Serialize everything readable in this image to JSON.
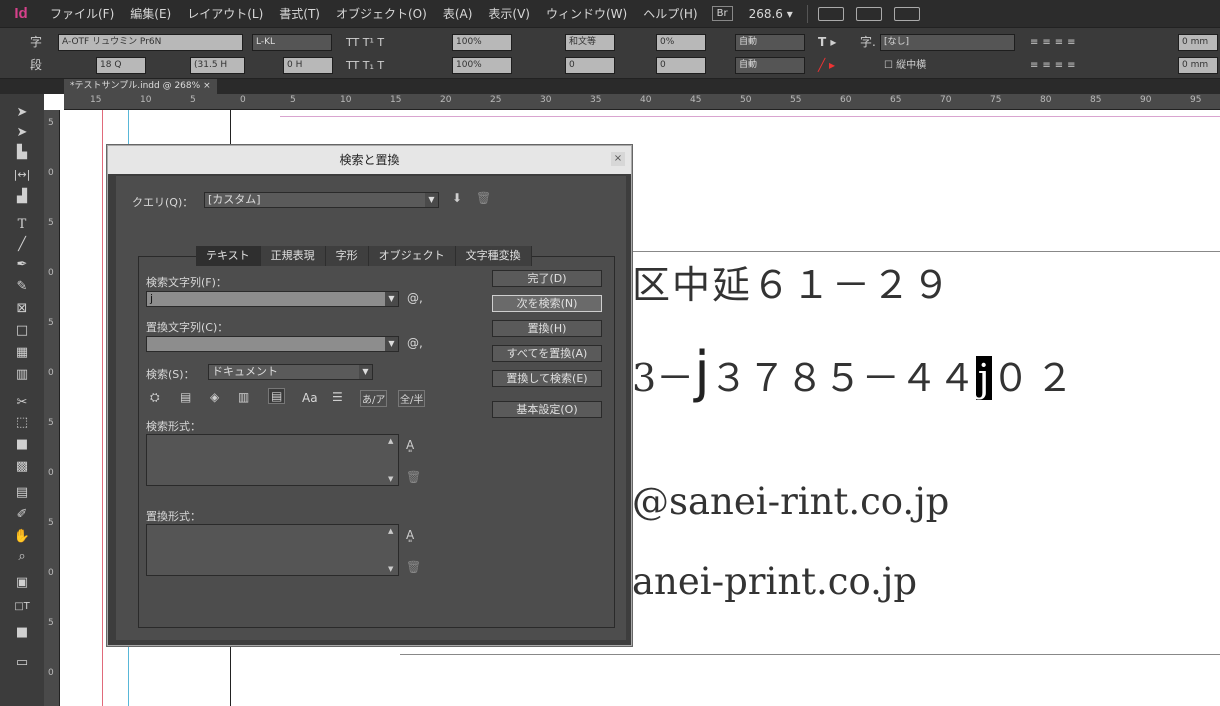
{
  "menubar": {
    "logo": "Id",
    "items": [
      "ファイル(F)",
      "編集(E)",
      "レイアウト(L)",
      "書式(T)",
      "オブジェクト(O)",
      "表(A)",
      "表示(V)",
      "ウィンドウ(W)",
      "ヘルプ(H)"
    ],
    "bridge": "Br",
    "zoom": "268.6 ▾"
  },
  "control": {
    "char_label": "字",
    "para_label": "段",
    "font": "A-OTF リュウミン Pr6N",
    "weight": "L-KL",
    "size": "18 Q",
    "leading": "(31.5 H",
    "baseline": "0 H",
    "scale_v": "100%",
    "scale_h": "100%",
    "kerning": "和文等",
    "tracking": "0",
    "tsume": "0%",
    "aki": "0",
    "auto1": "自動",
    "auto2": "自動",
    "style": "[なし]",
    "tate": "縦中横",
    "indent1": "0 mm",
    "indent2": "0 mm"
  },
  "doc": {
    "tab": "*テストサンプル.indd @ 268%",
    "ruler_h": [
      "15",
      "10",
      "5",
      "0",
      "5",
      "10",
      "15",
      "20",
      "25",
      "30",
      "35",
      "40",
      "45",
      "50",
      "55",
      "60",
      "65",
      "70",
      "75",
      "80",
      "85",
      "90",
      "95"
    ],
    "ruler_v": [
      "5",
      "0",
      "5",
      "0",
      "5",
      "0",
      "5",
      "0",
      "5",
      "0",
      "5",
      "0"
    ],
    "line1": "区中延６１－２９",
    "line2a": "3－",
    "line2b": "j",
    "line2c": "３７８５－４４",
    "line2d": "j",
    "line2e": "０２",
    "line3": "@sanei-rint.co.jp",
    "line4": "anei-print.co.jp"
  },
  "dialog": {
    "title": "検索と置換",
    "close": "×",
    "query_label": "クエリ(Q)：",
    "query_value": "[カスタム]",
    "tabs": [
      "テキスト",
      "正規表現",
      "字形",
      "オブジェクト",
      "文字種変換"
    ],
    "find_label": "検索文字列(F)：",
    "find_value": "j",
    "replace_label": "置換文字列(C)：",
    "replace_value": "",
    "search_label": "検索(S)：",
    "search_value": "ドキュメント",
    "find_format_label": "検索形式：",
    "replace_format_label": "置換形式：",
    "buttons": [
      "完了(D)",
      "次を検索(N)",
      "置換(H)",
      "すべてを置換(A)",
      "置換して検索(E)",
      "基本設定(O)"
    ],
    "opt_aa": "Aa",
    "opt_kana": "あ/ア",
    "opt_width": "全/半"
  }
}
